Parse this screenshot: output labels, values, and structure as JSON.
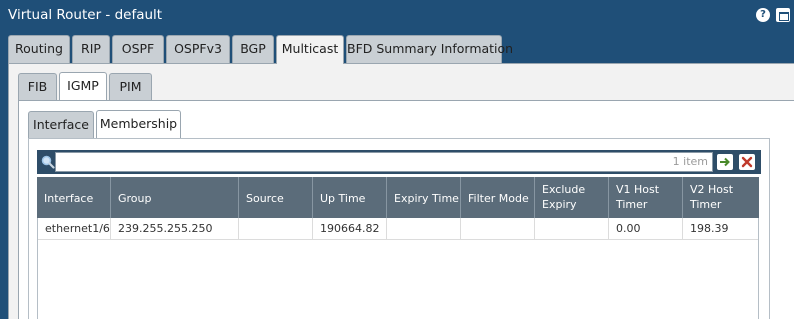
{
  "window": {
    "title": "Virtual Router - default",
    "icons": [
      "help-icon",
      "maximize-icon"
    ],
    "colors": {
      "titlebar": "#1f4f78",
      "table_header": "#5b6c7a",
      "search_bar": "#2e4d68"
    }
  },
  "tabs": [
    {
      "label": "Routing",
      "active": false
    },
    {
      "label": "RIP",
      "active": false
    },
    {
      "label": "OSPF",
      "active": false
    },
    {
      "label": "OSPFv3",
      "active": false
    },
    {
      "label": "BGP",
      "active": false
    },
    {
      "label": "Multicast",
      "active": true
    },
    {
      "label": "BFD Summary Information",
      "active": false
    }
  ],
  "subtabs": [
    {
      "label": "FIB",
      "active": false
    },
    {
      "label": "IGMP",
      "active": true
    },
    {
      "label": "PIM",
      "active": false
    }
  ],
  "inner_tabs": [
    {
      "label": "Interface",
      "active": false
    },
    {
      "label": "Membership",
      "active": true
    }
  ],
  "search": {
    "value": "",
    "placeholder": "",
    "item_count": "1 item",
    "icons": [
      "search-icon",
      "apply-filter-icon",
      "clear-filter-icon"
    ]
  },
  "table": {
    "columns": [
      [
        "Interface"
      ],
      [
        "Group"
      ],
      [
        "Source"
      ],
      [
        "Up Time"
      ],
      [
        "Expiry Time"
      ],
      [
        "Filter Mode"
      ],
      [
        "Exclude",
        "Expiry"
      ],
      [
        "V1 Host",
        "Timer"
      ],
      [
        "V2 Host",
        "Timer"
      ]
    ],
    "rows": [
      [
        "ethernet1/6",
        "239.255.255.250",
        "",
        "190664.82",
        "",
        "",
        "",
        "0.00",
        "198.39"
      ]
    ]
  }
}
